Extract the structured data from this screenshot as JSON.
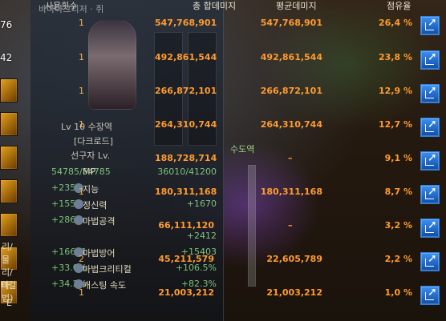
{
  "header": {
    "col1": "사용횟수",
    "col2": "총 합데미지",
    "col3": "평균데미지",
    "col4": "점유율"
  },
  "rows": [
    {
      "count": "1",
      "total": "547,768,901",
      "avg": "547,768,901",
      "share": "26,4 %"
    },
    {
      "count": "1",
      "total": "492,861,544",
      "avg": "492,861,544",
      "share": "23,8 %"
    },
    {
      "count": "1",
      "total": "266,872,101",
      "avg": "266,872,101",
      "share": "12,9 %"
    },
    {
      "count": "1",
      "total": "264,310,744",
      "avg": "264,310,744",
      "share": "12,7 %"
    },
    {
      "count": "",
      "total": "188,728,714",
      "avg": "–",
      "share": "9,1 %"
    },
    {
      "count": "1",
      "total": "180,311,168",
      "avg": "180,311,168",
      "share": "8,7 %"
    },
    {
      "count": "",
      "total": "66,111,120",
      "avg": "–",
      "share": "3,2 %"
    },
    {
      "count": "2",
      "total": "45,211,579",
      "avg": "22,605,789",
      "share": "2,2 %"
    },
    {
      "count": "1",
      "total": "21,003,212",
      "avg": "21,003,212",
      "share": "1,0 %"
    }
  ],
  "left": {
    "top1": "76",
    "top2": "42",
    "label1": "리/물리/마법)",
    "label2": "티컬",
    "label3": "E"
  },
  "character": {
    "top": "바마다그리저 · 쥐",
    "level": "Lv 10   수장역",
    "job1": "[다크로드]",
    "job2": "선구자 Lv."
  },
  "stats": [
    {
      "left": "54785/54785",
      "mid": "MP",
      "right": "36010/41200"
    },
    {
      "left": "+2351",
      "mid": "지능",
      "right": ""
    },
    {
      "left": "+1555",
      "mid": "정신력",
      "right": "+1670"
    },
    {
      "left": "+2862",
      "mid": "마법공격",
      "right": ""
    },
    {
      "left": "",
      "mid": "",
      "right": "+2412"
    },
    {
      "left": "+16661",
      "mid": "마법방어",
      "right": "+15403"
    },
    {
      "left": "+33.0%",
      "mid": "마법크리티컬",
      "right": "+106.5%"
    },
    {
      "left": "+34.2%",
      "mid": "캐스팅 속도",
      "right": "+82.3%"
    }
  ],
  "overlay": {
    "ace": "수도역"
  }
}
